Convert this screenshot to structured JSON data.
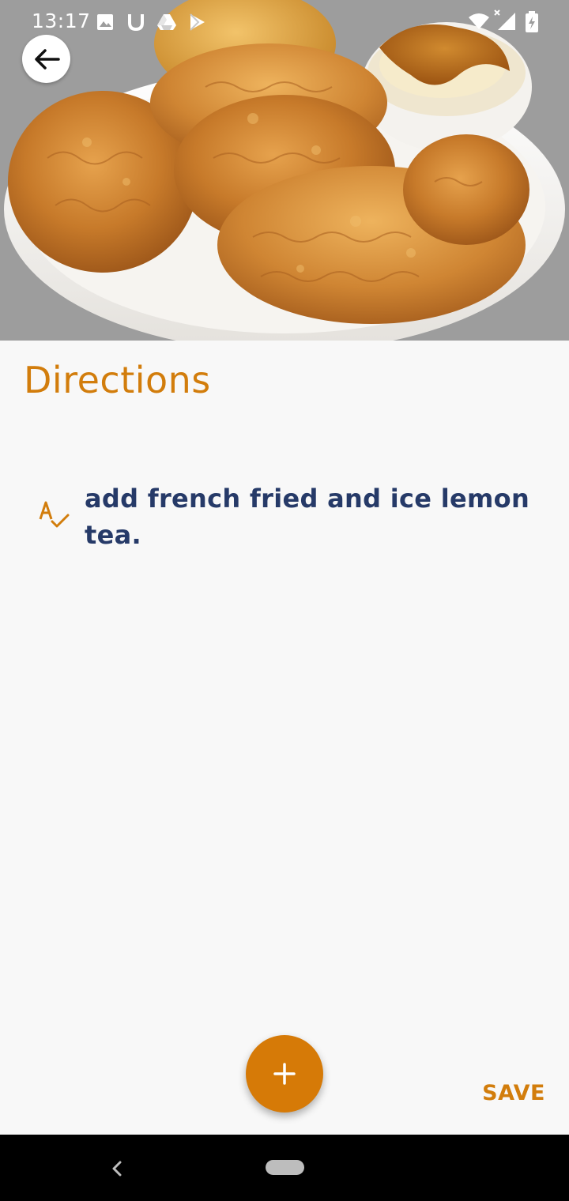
{
  "status_bar": {
    "time": "13:17",
    "left_icons": [
      "image-icon",
      "u-app-icon",
      "drive-icon",
      "play-store-icon"
    ],
    "right_icons": [
      "wifi-icon",
      "signal-icon",
      "battery-charging-icon"
    ]
  },
  "hero": {
    "image": "fried-chicken-plate-photo"
  },
  "back_button": {
    "icon": "arrow-left-icon"
  },
  "section": {
    "title": "Directions"
  },
  "directions": [
    {
      "icon": "spellcheck-icon",
      "text": "add french fried and ice lemon tea."
    }
  ],
  "fab": {
    "icon": "plus-icon"
  },
  "save_label": "SAVE",
  "nav_bar": {
    "back_icon": "nav-back-icon",
    "home_icon": "nav-home-pill-icon"
  },
  "colors": {
    "accent": "#d27d0c",
    "fab": "#d67a07",
    "text_primary": "#263a68",
    "background": "#f8f8f8",
    "nav_bar": "#000000"
  }
}
